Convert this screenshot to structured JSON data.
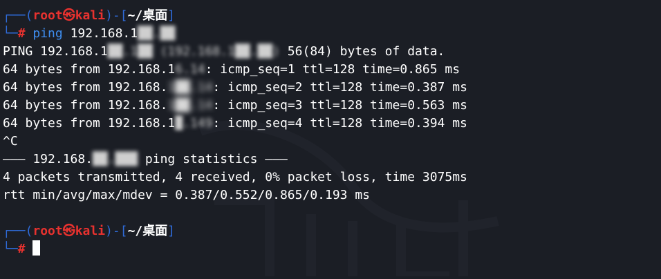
{
  "window": {
    "title": ""
  },
  "prompt1": {
    "corner_top": "┌──(",
    "user": "root",
    "at_icon": "㉿",
    "host": "kali",
    "sep": ")-[",
    "path": "~/桌面",
    "close": "]",
    "corner_bottom": "└─",
    "hash": "#",
    "command": "ping",
    "arg_visible": "192.168.1",
    "arg_redacted": "██.██"
  },
  "output": {
    "header_prefix": "PING 192.168.1",
    "header_redacted": "██.1██ (192.168.1██.██)",
    "header_suffix": " 56(84) bytes of data.",
    "replies": [
      {
        "prefix": "64 bytes from 192.168.1",
        "redacted": "6.14",
        "suffix": ": icmp_seq=1 ttl=128 time=0.865 ms"
      },
      {
        "prefix": "64 bytes from 192.168.",
        "redacted": "1██.14",
        "suffix": ": icmp_seq=2 ttl=128 time=0.387 ms"
      },
      {
        "prefix": "64 bytes from 192.168.",
        "redacted": "1██.14",
        "suffix": ": icmp_seq=3 ttl=128 time=0.563 ms"
      },
      {
        "prefix": "64 bytes from 192.168.1",
        "redacted": "█.149",
        "suffix": ": icmp_seq=4 ttl=128 time=0.394 ms"
      }
    ],
    "interrupt": "^C",
    "stats_prefix": "——— 192.168.",
    "stats_redacted": "██.███",
    "stats_suffix": " ping statistics ———",
    "stats_line": "4 packets transmitted, 4 received, 0% packet loss, time 3075ms",
    "rtt_line": "rtt min/avg/max/mdev = 0.387/0.552/0.865/0.193 ms"
  },
  "prompt2": {
    "corner_top": "┌──(",
    "user": "root",
    "at_icon": "㉿",
    "host": "kali",
    "sep": ")-[",
    "path": "~/桌面",
    "close": "]",
    "corner_bottom": "└─",
    "hash": "#"
  },
  "colors": {
    "background": "#1b1e25",
    "prompt_frame": "#2f6bd8",
    "prompt_user": "#e8322f",
    "command": "#3f8ef0",
    "text": "#ffffff"
  }
}
